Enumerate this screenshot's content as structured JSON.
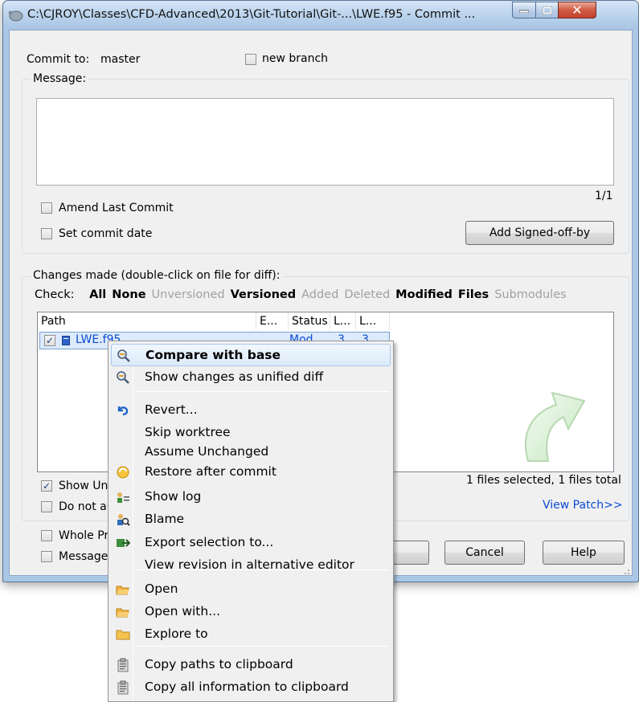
{
  "window": {
    "title": "C:\\CJROY\\Classes\\CFD-Advanced\\2013\\Git-Tutorial\\Git-...\\LWE.f95 - Commit ..."
  },
  "commit": {
    "commit_to_label": "Commit to:",
    "branch": "master",
    "new_branch_label": "new branch",
    "message_label": "Message:",
    "message_value": "",
    "counter": "1/1",
    "amend_label": "Amend Last Commit",
    "set_date_label": "Set commit date",
    "signed_off_button": "Add Signed-off-by"
  },
  "changes": {
    "group_label": "Changes made (double-click on file for diff):",
    "check_label": "Check:",
    "filters": [
      {
        "label": "All",
        "enabled": true
      },
      {
        "label": "None",
        "enabled": true
      },
      {
        "label": "Unversioned",
        "enabled": false
      },
      {
        "label": "Versioned",
        "enabled": true
      },
      {
        "label": "Added",
        "enabled": false
      },
      {
        "label": "Deleted",
        "enabled": false
      },
      {
        "label": "Modified",
        "enabled": true
      },
      {
        "label": "Files",
        "enabled": true
      },
      {
        "label": "Submodules",
        "enabled": false
      }
    ],
    "columns": [
      "Path",
      "E...",
      "Status",
      "L...",
      "L..."
    ],
    "rows": [
      {
        "path": "LWE.f95",
        "ext": "",
        "status": "Mod...",
        "lines_added": "3",
        "lines_removed": "3",
        "checked": true
      }
    ],
    "show_unversioned_label": "Show Unv",
    "do_not_auto_label": "Do not au",
    "selection_status": "1 files selected, 1 files total",
    "view_patch": "View Patch>>"
  },
  "bottom": {
    "whole_project_label": "Whole Pro",
    "message_only_label": "Message o",
    "cancel_button": "Cancel",
    "help_button": "Help"
  },
  "context_menu": {
    "items": [
      {
        "label": "Compare with base",
        "icon": "magnifier-diff-icon",
        "bold": true,
        "highlighted": true
      },
      {
        "label": "Show changes as unified diff",
        "icon": "magnifier-diff-icon"
      },
      {
        "label": "Revert...",
        "icon": "revert-arrow-icon"
      },
      {
        "label": "Skip worktree",
        "icon": ""
      },
      {
        "label": "Assume Unchanged",
        "icon": ""
      },
      {
        "label": "Restore after commit",
        "icon": "restore-icon"
      },
      {
        "label": "Show log",
        "icon": "log-icon"
      },
      {
        "label": "Blame",
        "icon": "blame-icon"
      },
      {
        "label": "Export selection to...",
        "icon": "export-icon"
      },
      {
        "label": "View revision in alternative editor",
        "icon": ""
      },
      {
        "label": "Open",
        "icon": "open-folder-icon"
      },
      {
        "label": "Open with...",
        "icon": "open-folder-icon"
      },
      {
        "label": "Explore to",
        "icon": "folder-icon"
      },
      {
        "label": "Copy paths to clipboard",
        "icon": "clipboard-icon"
      },
      {
        "label": "Copy all information to clipboard",
        "icon": "clipboard-icon"
      }
    ]
  },
  "colors": {
    "link": "#0b4bd4",
    "disabled": "#a0a0a0",
    "titlebar": "#b9d2ec"
  }
}
